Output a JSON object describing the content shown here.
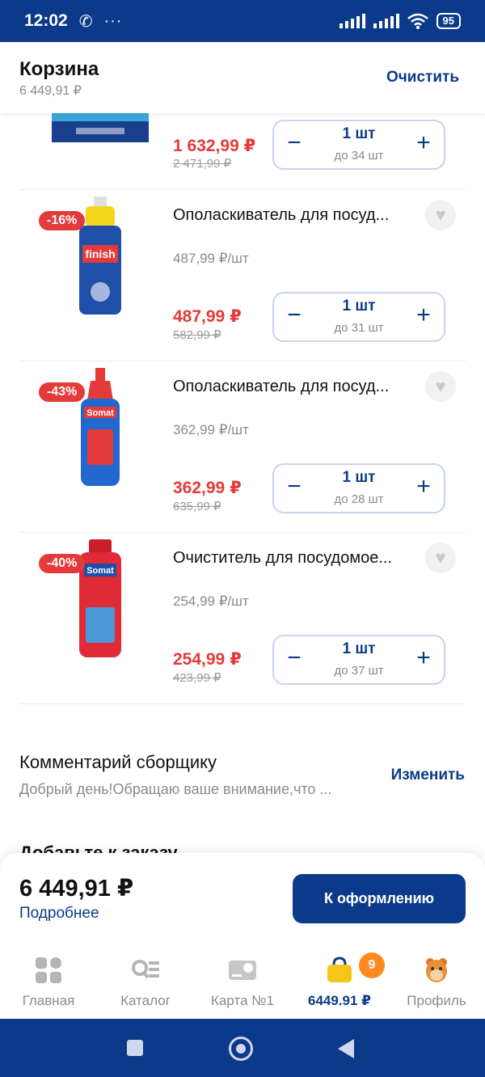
{
  "status_bar": {
    "time": "12:02",
    "battery": "95"
  },
  "header": {
    "title": "Корзина",
    "subtitle": "6 449,91 ₽",
    "clear_label": "Очистить"
  },
  "items": [
    {
      "discount": "",
      "name": "",
      "unit_price": "",
      "price": "1 632,99 ₽",
      "old_price": "2 471,99 ₽",
      "qty": "1 шт",
      "limit": "до 34 шт"
    },
    {
      "discount": "-16%",
      "name": "Ополаскиватель для посуд...",
      "unit_price": "487,99 ₽/шт",
      "price": "487,99 ₽",
      "old_price": "582,99 ₽",
      "qty": "1 шт",
      "limit": "до 31 шт"
    },
    {
      "discount": "-43%",
      "name": "Ополаскиватель для посуд...",
      "unit_price": "362,99 ₽/шт",
      "price": "362,99 ₽",
      "old_price": "635,99 ₽",
      "qty": "1 шт",
      "limit": "до 28 шт"
    },
    {
      "discount": "-40%",
      "name": "Очиститель для посудомое...",
      "unit_price": "254,99 ₽/шт",
      "price": "254,99 ₽",
      "old_price": "423,99 ₽",
      "qty": "1 шт",
      "limit": "до 37 шт"
    }
  ],
  "comment": {
    "title": "Комментарий сборщику",
    "text": "Добрый день!Обращаю ваше внимание,что ...",
    "edit_label": "Изменить"
  },
  "next_section_peek": "Добавьте к заказу",
  "checkout": {
    "total": "6 449,91 ₽",
    "details_label": "Подробнее",
    "button_label": "К оформлению"
  },
  "bottom_nav": {
    "items": [
      {
        "label": "Главная",
        "icon": "home-grid-icon"
      },
      {
        "label": "Каталог",
        "icon": "catalog-icon"
      },
      {
        "label": "Карта №1",
        "icon": "loyalty-card-icon"
      },
      {
        "label": "6449.91 ₽",
        "icon": "cart-bag-icon"
      },
      {
        "label": "Профиль",
        "icon": "hamster-avatar-icon"
      }
    ],
    "cart_badge": "9"
  },
  "colors": {
    "brand": "#0b3a8a",
    "sale": "#e53a3a",
    "badge": "#ff8a1f"
  }
}
